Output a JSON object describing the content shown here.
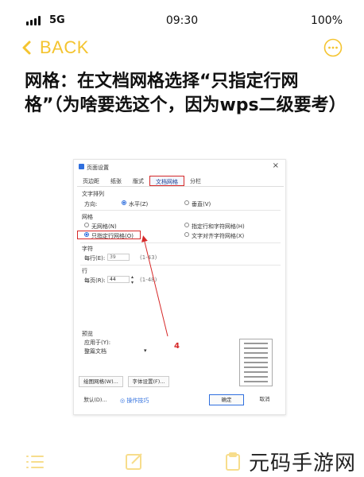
{
  "status_bar": {
    "network": "5G",
    "time": "09:30",
    "battery": "100%"
  },
  "nav": {
    "back_label": "BACK",
    "accent_color": "#f4c430"
  },
  "article": {
    "title": "网格：在文档网格选择“只指定行网格”（为啥要选这个，因为wps二级要考）"
  },
  "dialog": {
    "title": "页面设置",
    "tabs": [
      "页边距",
      "纸张",
      "版式",
      "文档网格",
      "分栏"
    ],
    "active_tab": "文档网格",
    "text_direction_header": "文字排列",
    "direction_label": "方向:",
    "direction_options": [
      "水平(Z)",
      "垂直(V)"
    ],
    "grid_header": "网格",
    "grid_options": [
      "无网格(N)",
      "只指定行网格(O)",
      "指定行和字符网格(H)",
      "文字对齐字符网格(X)"
    ],
    "chars_header": "字符",
    "chars_per_line_label": "每行(E):",
    "chars_per_line_value": "39",
    "chars_range": "(1-43)",
    "lines_header": "行",
    "lines_per_page_label": "每页(R):",
    "lines_per_page_value": "44",
    "lines_range": "(1-48)",
    "preview_header": "预览",
    "apply_to_label": "应用于(Y):",
    "apply_to_value": "整篇文档",
    "draw_grid_button": "绘图网格(W)...",
    "font_settings_button": "字体设置(F)...",
    "default_button": "默认(D)...",
    "tips_link": "操作技巧",
    "ok_button": "确定",
    "cancel_button": "取消",
    "annotation_number": "4"
  },
  "watermark": "元码手游网"
}
